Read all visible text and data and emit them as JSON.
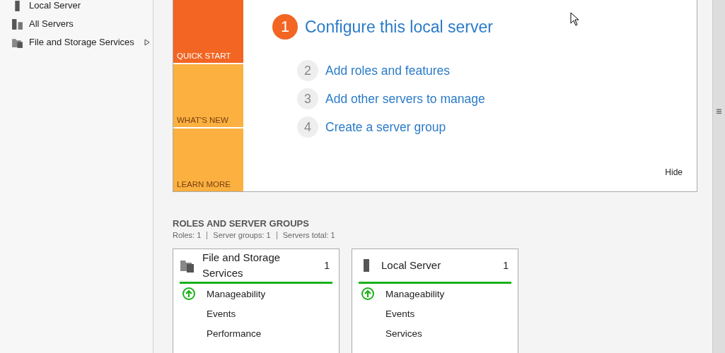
{
  "sidebar": {
    "items": [
      {
        "label": "Local Server",
        "kind": "server",
        "has_children": false
      },
      {
        "label": "All Servers",
        "kind": "servers",
        "has_children": false
      },
      {
        "label": "File and Storage Services",
        "kind": "storage",
        "has_children": true
      }
    ]
  },
  "welcome": {
    "tiles": [
      {
        "label": "QUICK START",
        "selected": true
      },
      {
        "label": "WHAT'S NEW",
        "selected": false
      },
      {
        "label": "LEARN MORE",
        "selected": false
      }
    ],
    "steps": [
      {
        "number": "1",
        "label": "Configure this local server",
        "selected": true
      },
      {
        "number": "2",
        "label": "Add roles and features",
        "selected": false
      },
      {
        "number": "3",
        "label": "Add other servers to manage",
        "selected": false
      },
      {
        "number": "4",
        "label": "Create a server group",
        "selected": false
      }
    ],
    "hide": "Hide"
  },
  "roles": {
    "title": "ROLES AND SERVER GROUPS",
    "summary": [
      "Roles: 1",
      "Server groups: 1",
      "Servers total: 1"
    ],
    "cards": [
      {
        "title": "File and Storage Services",
        "kind": "storage",
        "count": "1",
        "rows": [
          {
            "label": "Manageability",
            "kind": "ok"
          },
          {
            "label": "Events",
            "kind": "plain"
          },
          {
            "label": "Performance",
            "kind": "plain"
          }
        ]
      },
      {
        "title": "Local Server",
        "kind": "server",
        "count": "1",
        "rows": [
          {
            "label": "Manageability",
            "kind": "ok"
          },
          {
            "label": "Events",
            "kind": "plain"
          },
          {
            "label": "Services",
            "kind": "plain"
          }
        ]
      }
    ]
  }
}
